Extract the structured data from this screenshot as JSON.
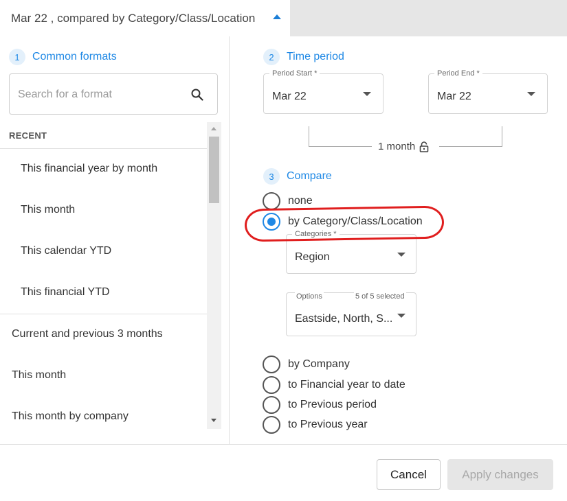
{
  "header": {
    "summary": "Mar 22 , compared by Category/Class/Location"
  },
  "formats": {
    "step": "1",
    "title": "Common formats",
    "search_placeholder": "Search for a format",
    "recent_label": "RECENT",
    "recent_items": [
      "This financial year by month",
      "This month",
      "This calendar YTD",
      "This financial YTD"
    ],
    "other_items": [
      "Current and previous 3 months",
      "This month",
      "This month by company"
    ]
  },
  "time_period": {
    "step": "2",
    "title": "Time period",
    "start_label": "Period Start *",
    "start_value": "Mar 22",
    "end_label": "Period End *",
    "end_value": "Mar 22",
    "duration": "1 month"
  },
  "compare": {
    "step": "3",
    "title": "Compare",
    "options": {
      "none": "none",
      "category": "by Category/Class/Location",
      "company": "by Company",
      "fytd": "to Financial year to date",
      "prev_period": "to Previous period",
      "prev_year": "to Previous year"
    },
    "selected": "category",
    "categories_label": "Categories *",
    "categories_value": "Region",
    "options_label": "Options",
    "options_count": "5 of 5 selected",
    "options_value": "Eastside, North, S..."
  },
  "footer": {
    "cancel_label": "Cancel",
    "apply_label": "Apply changes"
  },
  "colors": {
    "accent": "#1e88e5",
    "annotation": "#e01e1e",
    "disabled_button": "#e6e6e6"
  },
  "icons": [
    "caret-up-icon",
    "search-icon",
    "caret-down-icon",
    "lock-icon",
    "scroll-up-icon",
    "scroll-down-icon"
  ]
}
